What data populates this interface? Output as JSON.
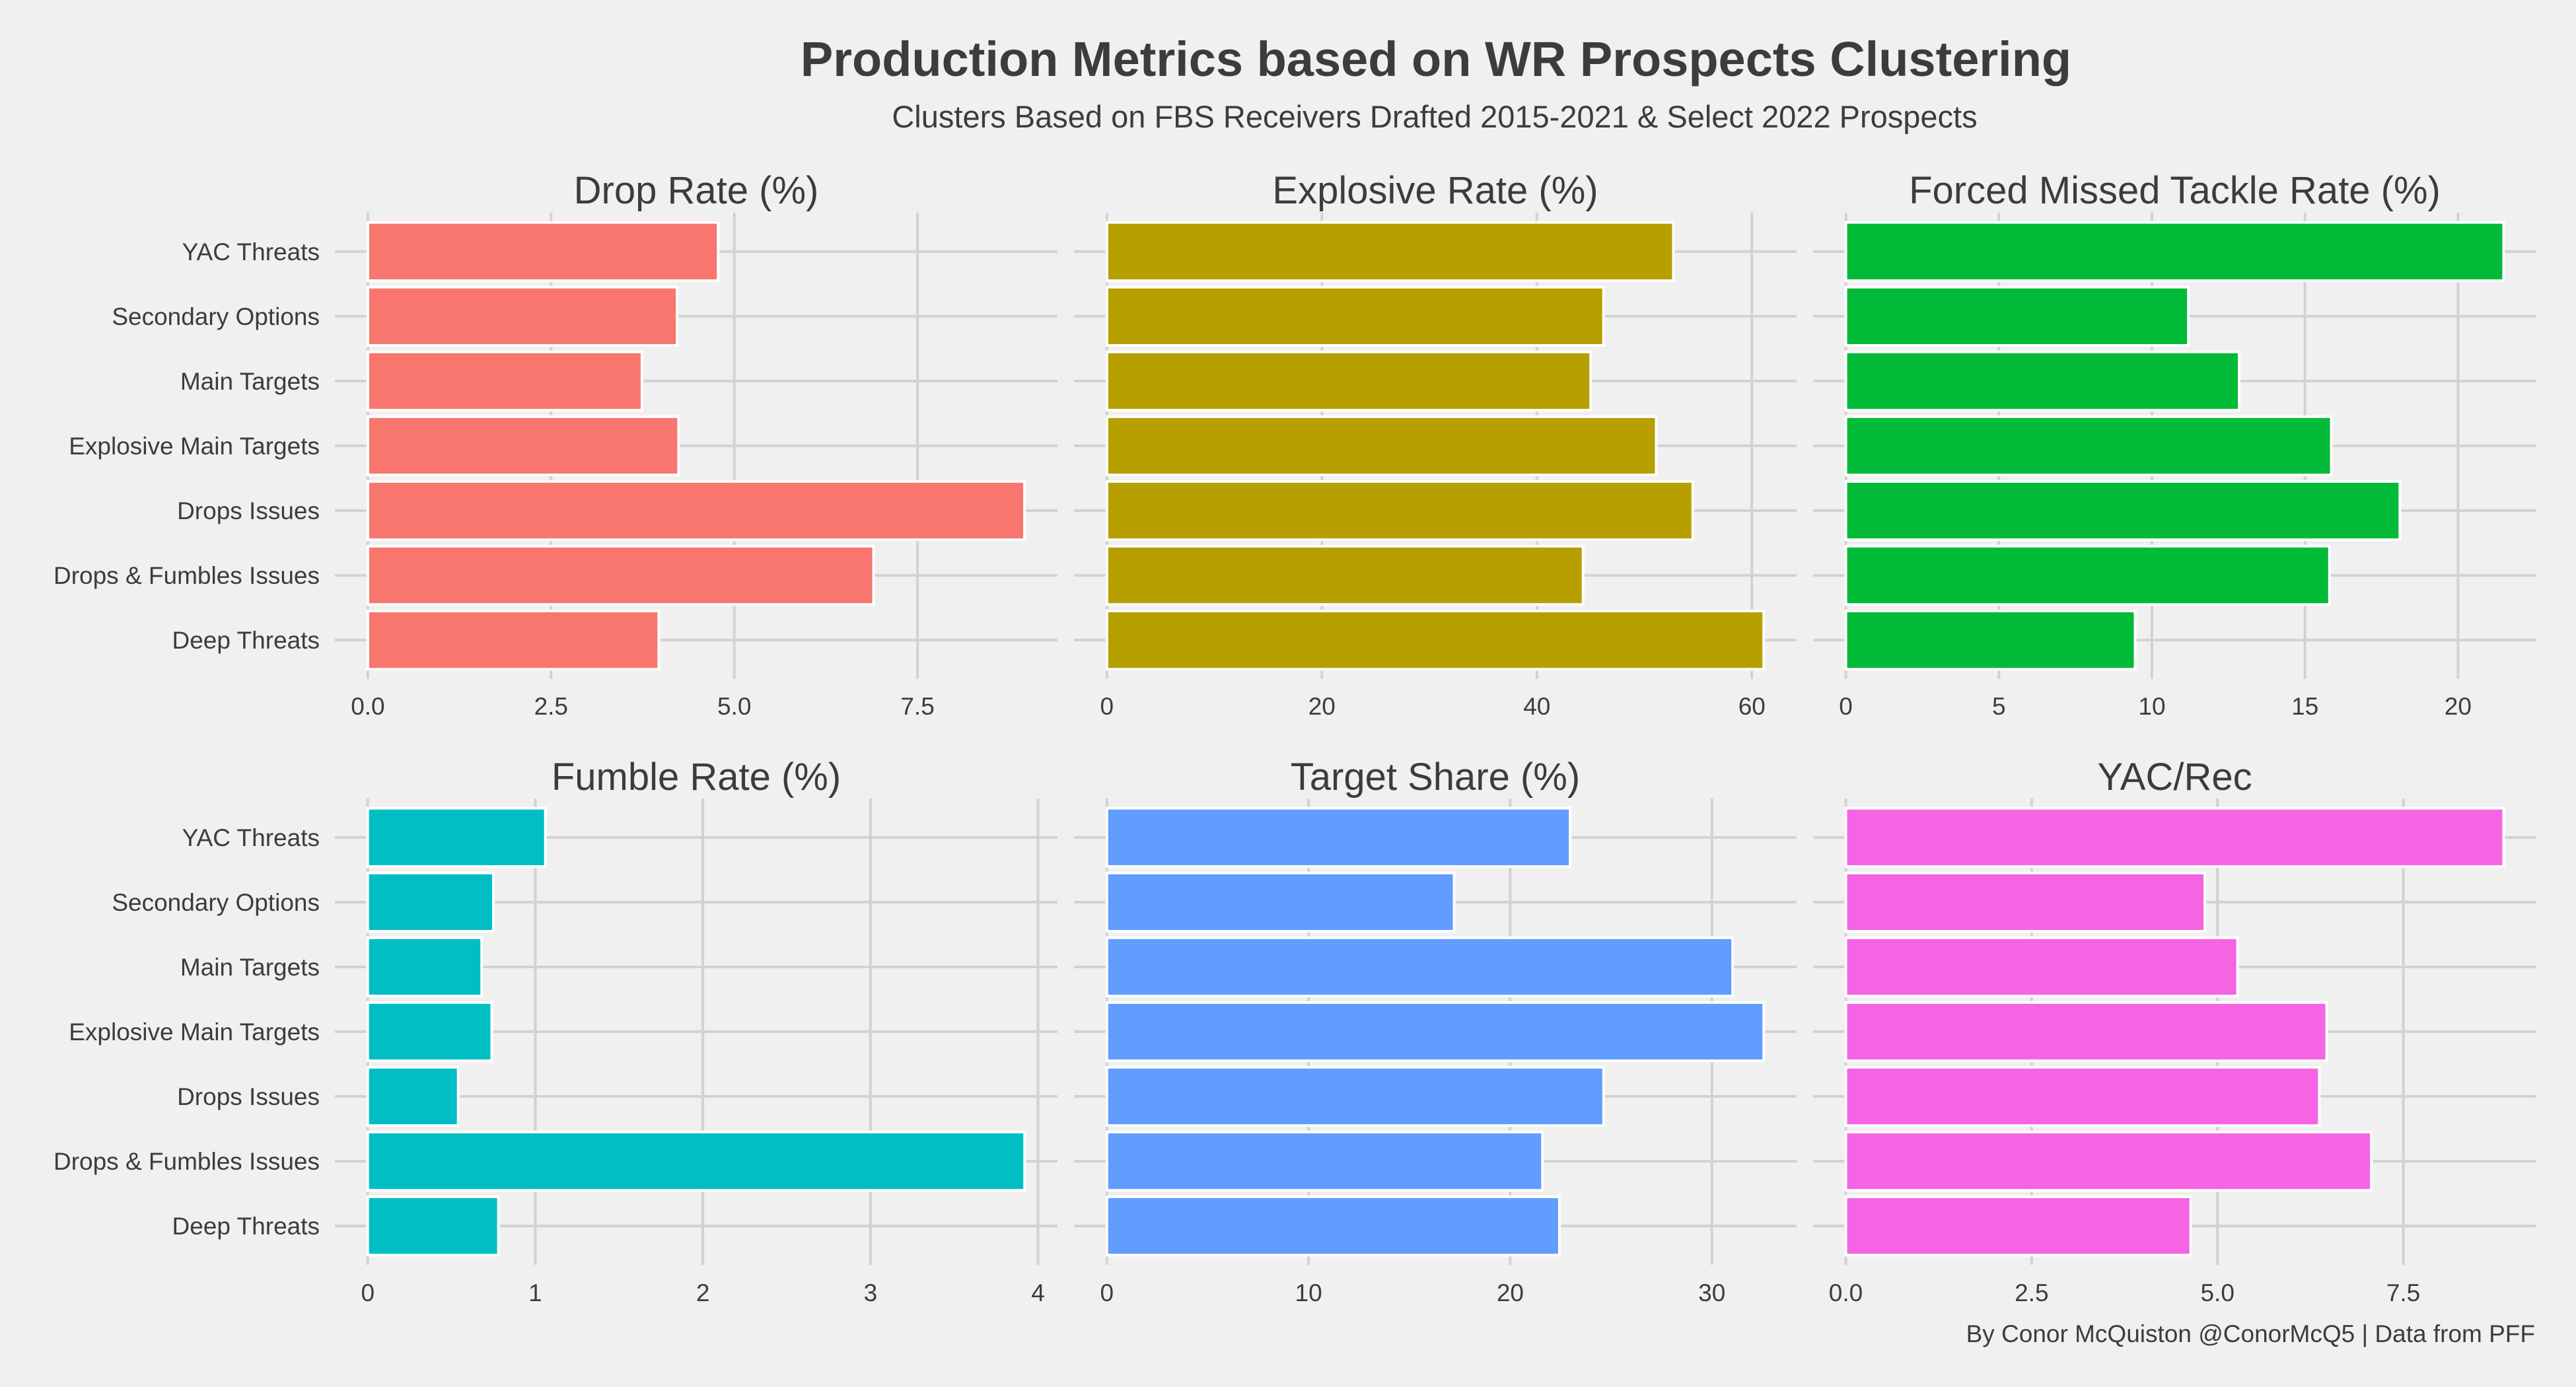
{
  "chart_data": {
    "type": "bar",
    "orientation": "horizontal",
    "layout": "facet-grid-2x3",
    "title": "Production Metrics based on WR Prospects Clustering",
    "subtitle": "Clusters Based on FBS Receivers Drafted 2015-2021 & Select 2022 Prospects",
    "caption": "By Conor McQuiston @ConorMcQ5 | Data from PFF",
    "categories": [
      "YAC Threats",
      "Secondary Options",
      "Main Targets",
      "Explosive Main Targets",
      "Drops Issues",
      "Drops & Fumbles Issues",
      "Deep Threats"
    ],
    "grid": true,
    "legend": "none",
    "panels": [
      {
        "title": "Drop Rate (%)",
        "color": "#F8766D",
        "values": [
          4.78,
          4.22,
          3.74,
          4.24,
          8.96,
          6.9,
          3.97
        ],
        "ticks": [
          0,
          2.5,
          5,
          7.5
        ],
        "tick_labels": [
          "0.0",
          "2.5",
          "5.0",
          "7.5"
        ],
        "xlim": [
          -0.45,
          9.41
        ]
      },
      {
        "title": "Explosive Rate (%)",
        "color": "#B79F00",
        "values": [
          52.7,
          46.2,
          45.0,
          51.1,
          54.5,
          44.3,
          61.1
        ],
        "ticks": [
          0,
          20,
          40,
          60
        ],
        "tick_labels": [
          "0",
          "20",
          "40",
          "60"
        ],
        "xlim": [
          -3.06,
          64.16
        ]
      },
      {
        "title": "Forced Missed Tackle Rate (%)",
        "color": "#00BA38",
        "values": [
          21.49,
          11.19,
          12.85,
          15.86,
          18.1,
          15.8,
          9.45
        ],
        "ticks": [
          0,
          5,
          10,
          15,
          20
        ],
        "tick_labels": [
          "0",
          "5",
          "10",
          "15",
          "20"
        ],
        "xlim": [
          -1.07,
          22.56
        ]
      },
      {
        "title": "Fumble Rate (%)",
        "color": "#00BFC4",
        "values": [
          1.06,
          0.75,
          0.68,
          0.74,
          0.54,
          3.92,
          0.78
        ],
        "ticks": [
          0,
          1,
          2,
          3,
          4
        ],
        "tick_labels": [
          "0",
          "1",
          "2",
          "3",
          "4"
        ],
        "xlim": [
          -0.196,
          4.116
        ]
      },
      {
        "title": "Target Share (%)",
        "color": "#619CFF",
        "values": [
          22.97,
          17.22,
          31.03,
          32.57,
          24.63,
          21.6,
          22.44
        ],
        "ticks": [
          0,
          10,
          20,
          30
        ],
        "tick_labels": [
          "0",
          "10",
          "20",
          "30"
        ],
        "xlim": [
          -1.63,
          34.2
        ]
      },
      {
        "title": "YAC/Rec",
        "color": "#F564E3",
        "values": [
          8.85,
          4.83,
          5.27,
          6.47,
          6.37,
          7.07,
          4.64
        ],
        "ticks": [
          0,
          2.5,
          5,
          7.5
        ],
        "tick_labels": [
          "0.0",
          "2.5",
          "5.0",
          "7.5"
        ],
        "xlim": [
          -0.44,
          9.29
        ]
      }
    ]
  }
}
